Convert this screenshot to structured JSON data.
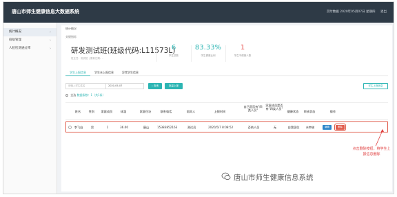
{
  "app": {
    "title": "唐山市师生健康信息大数据系统"
  },
  "topbar": {
    "datetime": "实时数据 2020年05月07日 星期四",
    "user": "退出"
  },
  "sidebar": {
    "items": [
      {
        "label": "统计概况",
        "chevron": "›"
      },
      {
        "label": "班级管理",
        "chevron": "›"
      },
      {
        "label": "人脸检测通过率",
        "chevron": "›"
      }
    ]
  },
  "breadcrumb": "统计概况",
  "section_label": "关键指标",
  "class_info": {
    "name": "研发测试班(班级代码:L11573L)",
    "sub": "班主任：测试班 | 更新日期：-"
  },
  "stats": [
    {
      "value": "6",
      "label": "学生总数",
      "accent": "#2cb5b3"
    },
    {
      "value": "83.33%",
      "label": "学生健康比例",
      "accent": "#2cb5b3"
    },
    {
      "value": "1",
      "label": "学生不健康人数",
      "accent": "#e8504e"
    }
  ],
  "tabs": [
    {
      "label": "学生上报信息"
    },
    {
      "label": "学生未上报信息"
    },
    {
      "label": "异常学生信息"
    }
  ],
  "toolbar": {
    "search_placeholder": "请输入学生姓名",
    "date_value": "2020-05-07",
    "search_label": "查询",
    "export_label": "批量上报",
    "right_label": "学生上报信息"
  },
  "selection": {
    "label": "全选",
    "count_label": "数据条数：1（共1条）"
  },
  "table": {
    "headers": [
      "姓名",
      "性别",
      "家庭成员",
      "体温",
      "家庭住址",
      "联系电话",
      "陪同人",
      "上报时间",
      "自己是否有\"四类人员\"",
      "家庭成员是否有\"四类人员\"",
      "健康状态",
      "审核状态",
      "操作"
    ],
    "rows": [
      [
        "李飞白",
        "男",
        "1",
        "36.00",
        "唐山",
        "15383852163",
        "测试员",
        "2020/5/7 8:08:52",
        "否热人员",
        "无",
        "自我居住",
        "未审核"
      ]
    ]
  },
  "ops": {
    "edit_label": "编辑",
    "delete_label": "删除"
  },
  "annotation": "点击删除按钮，将学生上报信息删除",
  "watermark": "唐山市师生健康信息系统"
}
